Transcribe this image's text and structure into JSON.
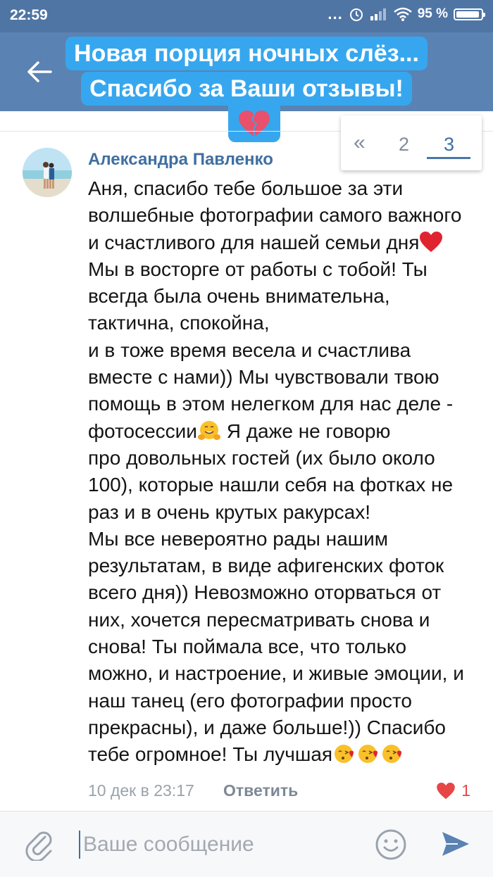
{
  "status_bar": {
    "time": "22:59",
    "dots": "...",
    "battery": "95 %",
    "battery_level": 0.95
  },
  "header": {
    "title_line1": "Новая порция ночных слёз...",
    "title_line2": "Спасибо за Ваши отзывы!",
    "badge_icon": "broken-heart-icon"
  },
  "pagination": {
    "prev": "«",
    "pages": [
      "2",
      "3"
    ],
    "current": "3"
  },
  "comment": {
    "author": "Александра Павленко",
    "text_1": "Аня, спасибо тебе большое за эти волшебные фотографии самого важного и счастливого для нашей семьи дня",
    "text_2": " Мы в восторге от работы с тобой! Ты всегда была очень внимательна, тактична, спокойна,\nи в тоже время весела и счастлива вместе с нами)) Мы чувствовали твою помощь в этом нелегком для нас деле - фотосессии",
    "text_3": " Я даже не говорю\nпро довольных гостей (их было около 100), которые нашли себя на фотках не раз и в очень крутых ракурсах!\nМы все невероятно рады нашим результатам, в виде афигенских фоток всего дня)) Невозможно оторваться от них, хочется пересматривать снова и снова! Ты поймала все, что только можно, и настроение, и живые эмоции, и наш танец (его фотографии просто прекрасны), и даже больше!)) Спасибо тебе огромное! Ты лучшая",
    "date": "10 дек в 23:17",
    "reply_label": "Ответить",
    "likes": "1"
  },
  "composer": {
    "placeholder": "Ваше сообщение"
  },
  "colors": {
    "header": "#5a82b3",
    "status_bar": "#4f75a4",
    "highlight": "#36a7ef",
    "link": "#3f6fa1",
    "like": "#e64646"
  }
}
